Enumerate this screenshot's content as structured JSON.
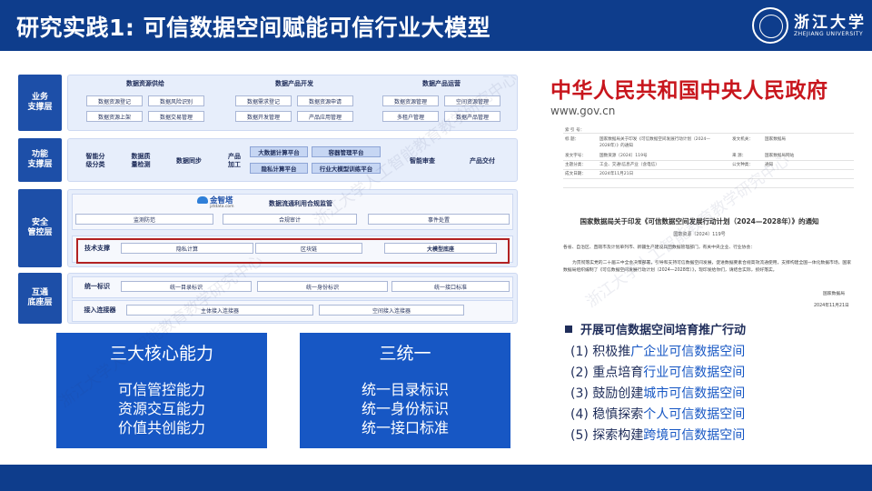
{
  "header": {
    "title": "研究实践1: 可信数据空间赋能可信行业大模型",
    "logo_name": "浙江大学",
    "logo_sub": "ZHEJIANG UNIVERSITY"
  },
  "arch": {
    "layers": {
      "business": "业务\n支撑层",
      "function": "功能\n支撑层",
      "security": "安全\n管控层",
      "base": "互通\n底座层"
    },
    "business": {
      "groups": [
        {
          "title": "数据资源供给",
          "items": [
            "数据资源登记",
            "数据风险识别",
            "数据资源上架",
            "数据交易管理"
          ]
        },
        {
          "title": "数据产品开发",
          "items": [
            "数据需求登记",
            "数据资源申请",
            "数据开发管理",
            "产品应用管理"
          ]
        },
        {
          "title": "数据产品运营",
          "items": [
            "数据资源管理",
            "空间资源管理",
            "多租户管理",
            "数据产品管理"
          ]
        }
      ]
    },
    "function": {
      "item1": "智能分\n级分类",
      "item2": "数据质\n量检测",
      "item3": "数据同步",
      "product_label": "产品\n加工",
      "product_items": [
        "大数据计算平台",
        "容器管理平台",
        "隐私计算平台",
        "行业大模型训练平台"
      ],
      "item4": "智能审查",
      "item5": "产品交付"
    },
    "security": {
      "brand": "金智塔",
      "brand_url": "jztdata.com",
      "title": "数据流通利用合规监管",
      "items": [
        "监测防范",
        "合规审计",
        "事件处置"
      ],
      "tech_label": "技术支撑",
      "tech_items": [
        "隐私计算",
        "区块链",
        "大模型底座"
      ]
    },
    "base": {
      "id_label": "统一标识",
      "id_items": [
        "统一目录标识",
        "统一身份标识",
        "统一接口标准"
      ],
      "conn_label": "接入连接器",
      "conn_items": [
        "主体接入连接器",
        "空间接入连接器"
      ]
    }
  },
  "box_left": {
    "title": "三大核心能力",
    "lines": [
      "可信管控能力",
      "资源交互能力",
      "价值共创能力"
    ]
  },
  "box_right": {
    "title": "三统一",
    "lines": [
      "统一目录标识",
      "统一身份标识",
      "统一接口标准"
    ]
  },
  "gov": {
    "title": "中华人民共和国中央人民政府",
    "url": "www.gov.cn",
    "meta": {
      "index_label": "索 引 号：",
      "title_label": "标 题：",
      "title_value": "国家数据局关于印发《可信数据空间发展行动计划（2024—",
      "title_value2": "2028年）》的通知",
      "issuer_label": "发文机关：",
      "issuer_value": "国家数据局",
      "docno_label": "发文字号：",
      "docno_value": "国数资源〔2024〕119号",
      "source_label": "来 源：",
      "source_value": "国家数据局网站",
      "topic_label": "主题分类：",
      "topic_value": "工业、交通\\信息产业（含电信）",
      "format_label": "公文种类：",
      "format_value": "通知",
      "date_label": "成文日期：",
      "date_value": "2024年11月21日"
    },
    "doc_title": "国家数据局关于印发《可信数据空间发展行动计划（2024—2028年）》的通知",
    "doc_no": "国数资源〔2024〕119号",
    "salutation": "各省、自治区、直辖市及计划单列市、新疆生产建设兵团数据管理部门，有关中央企业、行业协会：",
    "body": "为贯彻落实党的二十届三中全会决策部署，引导和支持可信数据空间发展，促进数据要素合规高效流通使用，支撑构建全国一体化数据市场，国家数据局组织编制了《可信数据空间发展行动计划（2024—2028年）》，现印发给你们，请结合实际，抓好落实。",
    "sign": "国家数据局",
    "sign_date": "2024年11月21日"
  },
  "actions": {
    "title": "开展可信数据空间培育推广行动",
    "items": [
      {
        "prefix": "(1)  积极推",
        "highlight": "广企业可信数据空间"
      },
      {
        "prefix": "(2)  重点培育",
        "highlight": "行业可信数据空间"
      },
      {
        "prefix": "(3)  鼓励创建",
        "highlight": "城市可信数据空间"
      },
      {
        "prefix": "(4)  稳慎探索",
        "highlight": "个人可信数据空间"
      },
      {
        "prefix": "(5)  探索构建",
        "highlight": "跨境可信数据空间"
      }
    ]
  },
  "watermark": "浙江大学人工智能教育教学研究中心"
}
